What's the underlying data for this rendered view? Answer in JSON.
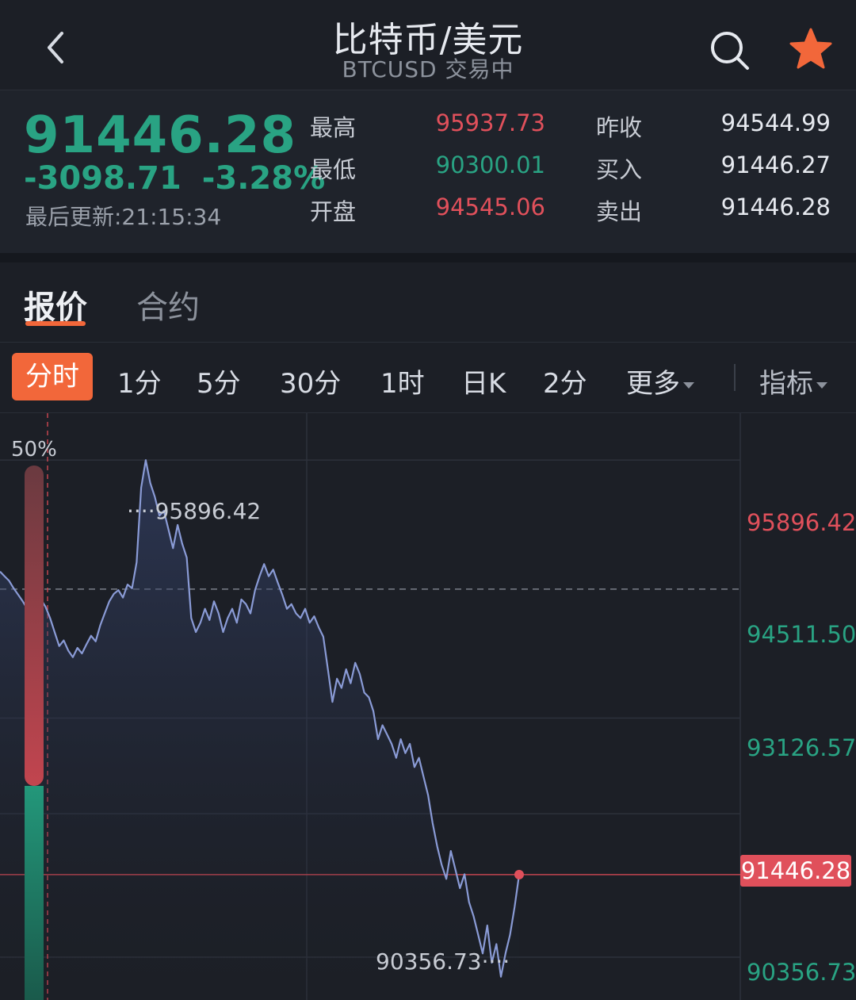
{
  "header": {
    "title": "比特币/美元",
    "subtitle": "BTCUSD 交易中"
  },
  "quote": {
    "price": "91446.28",
    "change": "-3098.71",
    "change_pct": "-3.28%",
    "updated": "最后更新:21:15:34",
    "stats": [
      {
        "label": "最高",
        "value": "95937.73",
        "color": "#e0505b"
      },
      {
        "label": "最低",
        "value": "90300.01",
        "color": "#29a383"
      },
      {
        "label": "开盘",
        "value": "94545.06",
        "color": "#e0505b"
      },
      {
        "label": "昨收",
        "value": "94544.99",
        "color": "#e6e9ef"
      },
      {
        "label": "买入",
        "value": "91446.27",
        "color": "#e6e9ef"
      },
      {
        "label": "卖出",
        "value": "91446.28",
        "color": "#e6e9ef"
      }
    ]
  },
  "tabs": {
    "quote": "报价",
    "contract": "合约"
  },
  "periods": {
    "active": "分时",
    "items": [
      "1分",
      "5分",
      "30分",
      "1时",
      "日K",
      "2分"
    ],
    "more": "更多",
    "indicators": "指标"
  },
  "chart": {
    "pct_label": "50%",
    "high_annot": "95896.42",
    "low_annot": "90356.73",
    "current_tag": "91446.28",
    "axis": [
      {
        "label": "95896.42",
        "color": "#e0505b"
      },
      {
        "label": "94511.50",
        "color": "#29a383"
      },
      {
        "label": "93126.57",
        "color": "#29a383"
      },
      {
        "label": "90356.73",
        "color": "#29a383"
      }
    ]
  },
  "chart_data": {
    "type": "line",
    "series": [
      {
        "values": [
          94700,
          94650,
          94600,
          94520,
          94450,
          94380,
          94300,
          94180,
          94250,
          94400,
          94320,
          94200,
          94050,
          93900,
          93960,
          93850,
          93780,
          93880,
          93820,
          93920,
          94010,
          93950,
          94120,
          94250,
          94380,
          94460,
          94500,
          94420,
          94560,
          94520,
          94800,
          95600,
          95896,
          95650,
          95500,
          95300,
          95350,
          95150,
          94950,
          95200,
          95000,
          94850,
          94200,
          94050,
          94150,
          94300,
          94180,
          94380,
          94250,
          94050,
          94200,
          94300,
          94150,
          94400,
          94350,
          94250,
          94500,
          94650,
          94780,
          94650,
          94720,
          94580,
          94450,
          94300,
          94350,
          94250,
          94200,
          94300,
          94150,
          94220,
          94100,
          94000,
          93650,
          93300,
          93550,
          93450,
          93650,
          93500,
          93720,
          93600,
          93400,
          93350,
          93200,
          92900,
          93050,
          92950,
          92850,
          92700,
          92900,
          92750,
          92850,
          92600,
          92700,
          92500,
          92300,
          92000,
          91750,
          91550,
          91400,
          91700,
          91500,
          91300,
          91450,
          91150,
          91000,
          90800,
          90600,
          90900,
          90500,
          90700,
          90350,
          90600,
          90800,
          91100,
          91446
        ]
      }
    ],
    "ylim": [
      90100,
      96400
    ],
    "current": 91446.28,
    "baseline": 94511.5,
    "high": 95896.42,
    "low": 90356.73
  }
}
